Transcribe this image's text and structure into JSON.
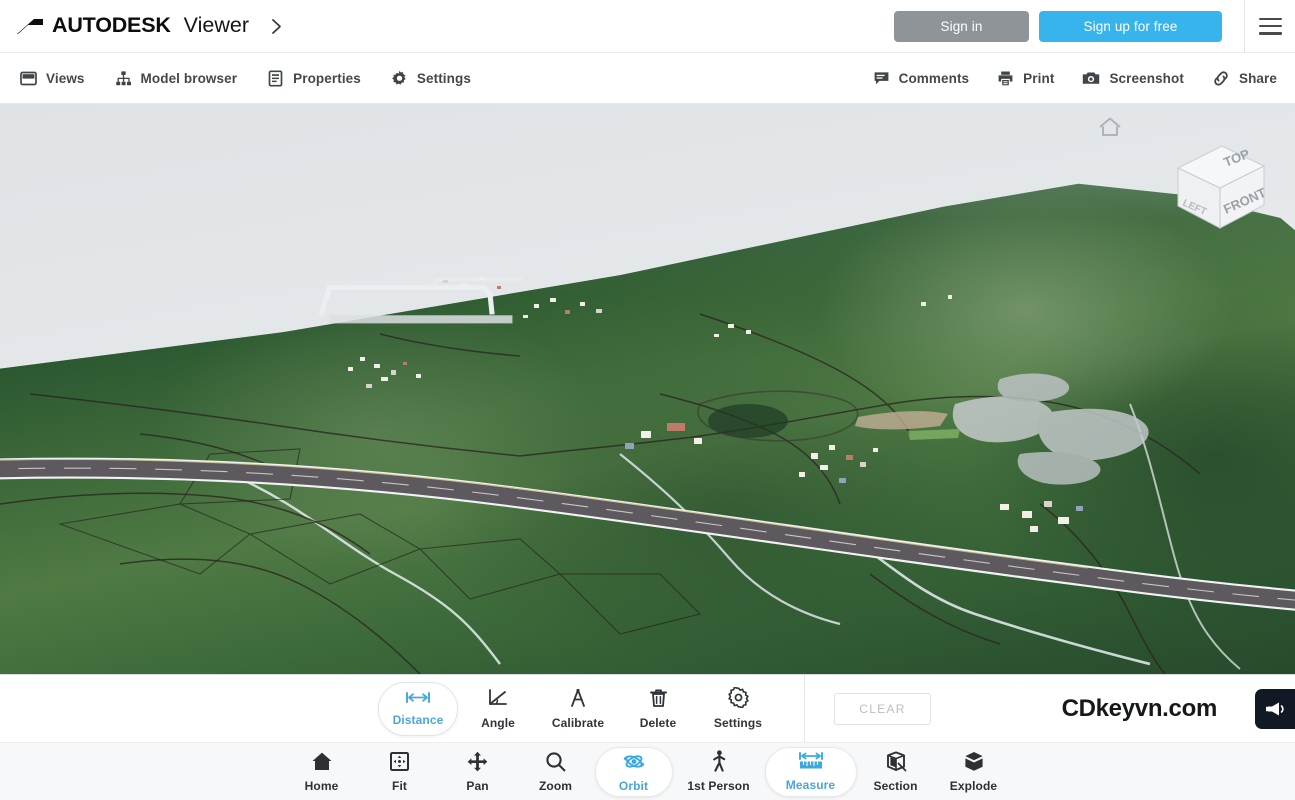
{
  "header": {
    "brand_autodesk": "AUTODESK",
    "brand_viewer": "Viewer",
    "logo_icon": "autodesk-logo-icon",
    "chevron_icon": "chevron-right-icon",
    "sign_in_label": "Sign in",
    "sign_up_label": "Sign up for free",
    "menu_icon": "hamburger-menu-icon",
    "signin_color": "#8f9498",
    "signup_color": "#37b4eb"
  },
  "toolbar": {
    "left_items": [
      {
        "label": "Views",
        "icon": "views-panel-icon"
      },
      {
        "label": "Model browser",
        "icon": "model-browser-tree-icon"
      },
      {
        "label": "Properties",
        "icon": "properties-list-icon"
      },
      {
        "label": "Settings",
        "icon": "gear-icon"
      }
    ],
    "right_items": [
      {
        "label": "Comments",
        "icon": "comment-bubble-icon"
      },
      {
        "label": "Print",
        "icon": "printer-icon"
      },
      {
        "label": "Screenshot",
        "icon": "camera-icon"
      },
      {
        "label": "Share",
        "icon": "link-chain-icon"
      }
    ]
  },
  "viewport": {
    "home_icon": "view-home-icon",
    "viewcube": {
      "top_label": "TOP",
      "front_label": "FRONT",
      "left_label": "LEFT"
    }
  },
  "measure_bar": {
    "tools": [
      {
        "label": "Distance",
        "icon": "distance-measure-icon",
        "active": true
      },
      {
        "label": "Angle",
        "icon": "angle-measure-icon",
        "active": false
      },
      {
        "label": "Calibrate",
        "icon": "calibrate-icon",
        "active": false
      },
      {
        "label": "Delete",
        "icon": "trash-icon",
        "active": false
      },
      {
        "label": "Settings",
        "icon": "gear-icon",
        "active": false
      }
    ],
    "clear_label": "CLEAR",
    "watermark": "CDkeyvn.com",
    "megaphone_icon": "megaphone-announcement-icon",
    "accent_color": "#3ca8e0"
  },
  "bottom_nav": {
    "tools": [
      {
        "label": "Home",
        "icon": "home-icon",
        "active": false
      },
      {
        "label": "Fit",
        "icon": "fit-to-view-icon",
        "active": false
      },
      {
        "label": "Pan",
        "icon": "pan-arrows-icon",
        "active": false
      },
      {
        "label": "Zoom",
        "icon": "magnifier-zoom-icon",
        "active": false
      },
      {
        "label": "Orbit",
        "icon": "orbit-icon",
        "active": true
      },
      {
        "label": "1st Person",
        "icon": "walking-person-icon",
        "active": false
      },
      {
        "label": "Measure",
        "icon": "ruler-measure-icon",
        "active": true
      },
      {
        "label": "Section",
        "icon": "section-cut-icon",
        "active": false
      },
      {
        "label": "Explode",
        "icon": "explode-cube-icon",
        "active": false
      }
    ]
  }
}
